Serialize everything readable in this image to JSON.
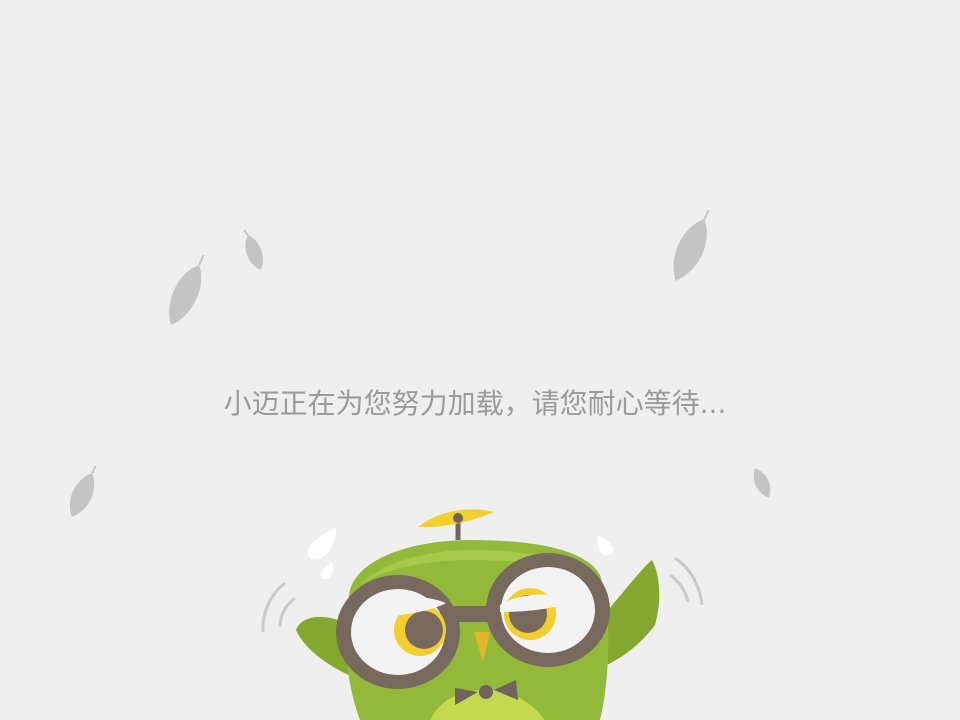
{
  "loading": {
    "message": "小迈正在为您努力加载，请您耐心等待..."
  },
  "colors": {
    "background": "#efefef",
    "text": "#9a9a9a",
    "leaf": "#c4c4c4",
    "owl_body": "#93b93a",
    "owl_glasses": "#77695e",
    "propeller": "#f2cf2e"
  },
  "icons": {
    "mascot": "owl-mascot",
    "leaves": "falling-leaf-icon"
  }
}
